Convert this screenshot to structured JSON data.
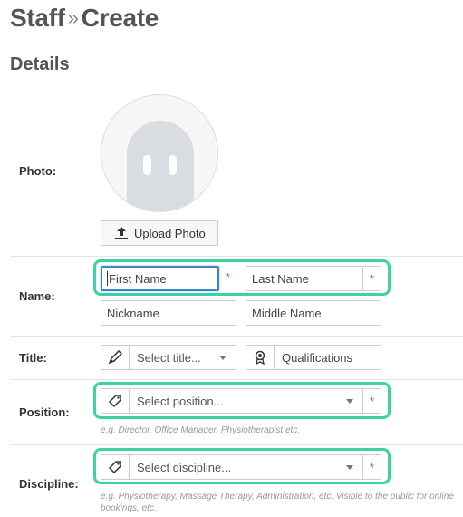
{
  "header": {
    "title_part1": "Staff",
    "separator": "»",
    "title_part2": "Create"
  },
  "section": {
    "title": "Details"
  },
  "photo": {
    "label": "Photo:",
    "upload_label": "Upload Photo"
  },
  "name": {
    "label": "Name:",
    "first_name_placeholder": "First Name",
    "last_name_placeholder": "Last Name",
    "nickname_placeholder": "Nickname",
    "middle_name_placeholder": "Middle Name",
    "required_mark": "*"
  },
  "title_row": {
    "label": "Title:",
    "title_select": "Select title...",
    "qualifications_placeholder": "Qualifications"
  },
  "position": {
    "label": "Position:",
    "select": "Select position...",
    "help": "e.g. Director, Office Manager, Physiotherapist etc.",
    "required_mark": "*"
  },
  "discipline": {
    "label": "Discipline:",
    "select": "Select discipline...",
    "help": "e.g. Physiotherapy, Massage Therapy, Administration, etc. Visible to the public for online bookings, etc.",
    "required_mark": "*"
  },
  "colors": {
    "accent_highlight": "#3dd1a6",
    "required": "#d9534f",
    "focus": "#3a87c8"
  },
  "icons": {
    "upload": "upload-icon",
    "pen": "pen-icon",
    "award": "award-icon",
    "tag": "tag-icon"
  }
}
